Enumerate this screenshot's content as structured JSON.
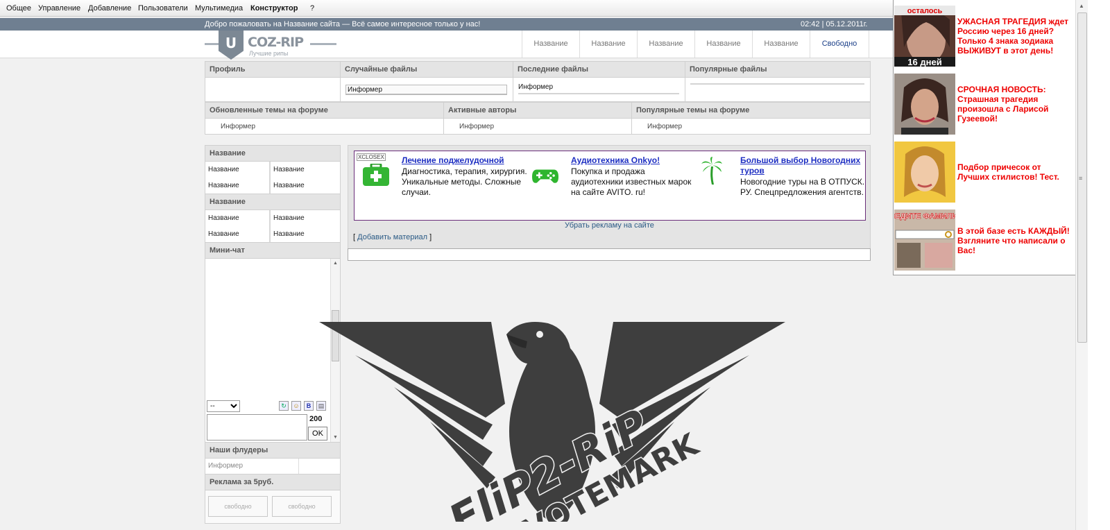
{
  "adminbar": {
    "items": [
      "Общее",
      "Управление",
      "Добавление",
      "Пользователи",
      "Мультимедиа",
      "Конструктор",
      "?"
    ]
  },
  "welcome": {
    "message": "Добро пожаловать на Название сайта — Всё самое интересное только у нас!",
    "datetime": "02:42 | 05.12.2011г."
  },
  "logo": {
    "letter": "U",
    "name": "COZ-RIP",
    "tagline": "Лучшие рипы"
  },
  "topnav": {
    "items": [
      "Название",
      "Название",
      "Название",
      "Название",
      "Название",
      "Свободно"
    ]
  },
  "informers_row1": {
    "headers": [
      "Профиль",
      "Случайные файлы",
      "Последние файлы",
      "Популярные файлы"
    ],
    "values": [
      "",
      "Информер",
      "Информер",
      ""
    ]
  },
  "informers_row2": {
    "headers": [
      "Обновленные темы на форуме",
      "Активные авторы",
      "Популярные темы на форуме"
    ],
    "values": [
      "Информер",
      "Информер",
      "Информер"
    ]
  },
  "sidebar": {
    "menu1": {
      "title": "Название",
      "items": [
        "Название",
        "Название",
        "Название",
        "Название"
      ]
    },
    "menu2": {
      "title": "Название",
      "items": [
        "Название",
        "Название",
        "Название",
        "Название"
      ]
    },
    "minichat": {
      "title": "Мини-чат",
      "select_value": "--",
      "counter": "200",
      "ok_label": "OK"
    },
    "flooders": {
      "title": "Наши флудеры",
      "value": "Информер"
    },
    "promo": {
      "title": "Реклама за 5руб.",
      "buttons": [
        "свободно",
        "свободно"
      ]
    }
  },
  "main": {
    "xclose": "XCLOSEX",
    "ads": [
      {
        "title": "Лечение поджелудочной",
        "text": "Диагностика, терапия, хирургия. Уникальные методы. Сложные случаи.",
        "icon": "first-aid-kit-icon"
      },
      {
        "title": "Аудиотехника Onkyo!",
        "text": "Покупка и продажа аудиотехники известных марок на сайте AVITO. ru!",
        "icon": "gamepad-icon"
      },
      {
        "title": "Большой выбор Новогодних туров",
        "text": "Новогодние туры на В ОТПУСК. РУ. Спецпредложения агентств.",
        "icon": "palm-tree-icon"
      }
    ],
    "remove_ads": "Убрать рекламу на сайте",
    "add_open": "[ ",
    "add_material": "Добавить материал",
    "add_close": " ]"
  },
  "watermark": {
    "line1": "FliP2-RiP",
    "line2": "VOTEMARK"
  },
  "right_ads": [
    {
      "badge_top": "осталось",
      "badge_bottom": "16 дней",
      "text": "УЖАСНАЯ ТРАГЕДИЯ ждет Россию через 16 дней? Только 4 знака зодиака ВЫЖИВУТ в этот день!"
    },
    {
      "text": "СРОЧНАЯ НОВОСТЬ: Страшная трагедия произошла с Ларисой Гузеевой!"
    },
    {
      "text": "Подбор причесок от Лучших стилистов! Тест."
    },
    {
      "badge_top": "ВВЕДИТЕ ФАМИЛИЮ",
      "text": "В этой базе есть КАЖДЫЙ! Взгляните что написали о Вас!"
    }
  ],
  "colors": {
    "accent_nav": "#1b3f88",
    "ad_red": "#ee0000",
    "welcome_bg": "#6f7f91",
    "ad_border": "#6a2d7a"
  }
}
